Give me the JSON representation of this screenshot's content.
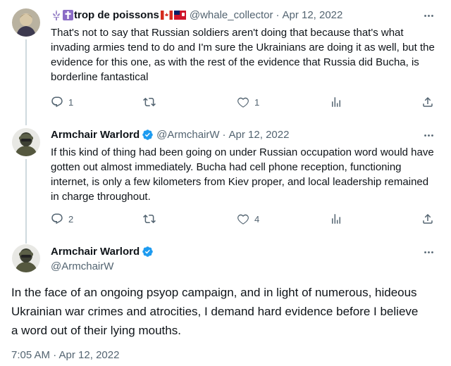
{
  "tweet1": {
    "display_name": "trop de poissons",
    "handle": "@whale_collector",
    "separator": "·",
    "date": "Apr 12, 2022",
    "text": "That's not to say that Russian soldiers aren't doing that because that's what invading armies tend to do and I'm sure the Ukrainians are doing it as well, but the evidence for this one, as with the rest of the evidence that Russia did Bucha, is borderline fantastical",
    "reply_count": "1",
    "retweet_count": "",
    "like_count": "1",
    "icons": [
      "fleur-de-lis-icon",
      "cross-icon",
      "canada-flag-icon",
      "bermuda-flag-icon",
      "more-icon",
      "reply-icon",
      "retweet-icon",
      "like-icon",
      "views-icon",
      "share-icon"
    ]
  },
  "tweet2": {
    "display_name": "Armchair Warlord",
    "handle": "@ArmchairW",
    "separator": "·",
    "date": "Apr 12, 2022",
    "text": "If this kind of thing had been going on under Russian occupation word would have gotten out almost immediately.  Bucha had cell phone reception, functioning internet, is only a few kilometers from Kiev proper, and local leadership remained in charge throughout.",
    "reply_count": "2",
    "retweet_count": "",
    "like_count": "4"
  },
  "main_tweet": {
    "display_name": "Armchair Warlord",
    "handle": "@ArmchairW",
    "text": "In the face of an ongoing psyop campaign, and in light of numerous, hideous Ukrainian war crimes and atrocities, I demand hard evidence before I believe a word out of their lying mouths.",
    "timestamp": "7:05 AM · Apr 12, 2022"
  },
  "colors": {
    "text": "#0f1419",
    "secondary": "#536471",
    "verified": "#1d9bf0",
    "thread_line": "#cfd9de"
  }
}
